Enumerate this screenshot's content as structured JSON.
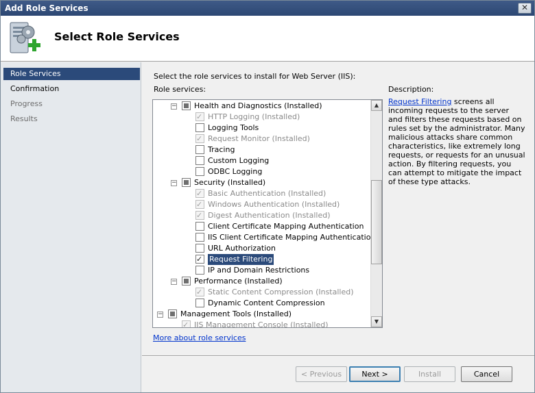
{
  "window": {
    "title": "Add Role Services",
    "close_glyph": "✕"
  },
  "header": {
    "title": "Select Role Services",
    "icon": "server-gears-add-icon"
  },
  "nav": {
    "items": [
      {
        "label": "Role Services",
        "state": "selected"
      },
      {
        "label": "Confirmation",
        "state": "normal"
      },
      {
        "label": "Progress",
        "state": "disabled"
      },
      {
        "label": "Results",
        "state": "disabled"
      }
    ]
  },
  "main": {
    "instruction": "Select the role services to install for Web Server (IIS):",
    "role_services_label": "Role services:",
    "description_label": "Description:",
    "description_link": "Request Filtering",
    "description_text": " screens all incoming requests to the server and filters these requests based on rules set by the administrator. Many malicious attacks share common characteristics, like extremely long requests, or requests for an unusual action. By filtering requests, you can attempt to mitigate the impact of these type attacks.",
    "more_link": "More about role services"
  },
  "tree": [
    {
      "label": "Health and Diagnostics",
      "suffix": "  (Installed)",
      "level": 1,
      "check": "partial",
      "expander": "⊟",
      "disabled": false
    },
    {
      "label": "HTTP Logging",
      "suffix": "  (Installed)",
      "level": 2,
      "check": "checked",
      "disabled": true
    },
    {
      "label": "Logging Tools",
      "suffix": "",
      "level": 2,
      "check": "none",
      "disabled": false
    },
    {
      "label": "Request Monitor",
      "suffix": "  (Installed)",
      "level": 2,
      "check": "checked",
      "disabled": true
    },
    {
      "label": "Tracing",
      "suffix": "",
      "level": 2,
      "check": "none",
      "disabled": false
    },
    {
      "label": "Custom Logging",
      "suffix": "",
      "level": 2,
      "check": "none",
      "disabled": false
    },
    {
      "label": "ODBC Logging",
      "suffix": "",
      "level": 2,
      "check": "none",
      "disabled": false
    },
    {
      "label": "Security",
      "suffix": "  (Installed)",
      "level": 1,
      "check": "partial",
      "expander": "⊟",
      "disabled": false
    },
    {
      "label": "Basic Authentication",
      "suffix": "  (Installed)",
      "level": 2,
      "check": "checked",
      "disabled": true
    },
    {
      "label": "Windows Authentication",
      "suffix": "  (Installed)",
      "level": 2,
      "check": "checked",
      "disabled": true
    },
    {
      "label": "Digest Authentication",
      "suffix": "  (Installed)",
      "level": 2,
      "check": "checked",
      "disabled": true
    },
    {
      "label": "Client Certificate Mapping Authentication",
      "suffix": "",
      "level": 2,
      "check": "none",
      "disabled": false
    },
    {
      "label": "IIS Client Certificate Mapping Authentication",
      "suffix": "",
      "level": 2,
      "check": "none",
      "disabled": false
    },
    {
      "label": "URL Authorization",
      "suffix": "",
      "level": 2,
      "check": "none",
      "disabled": false
    },
    {
      "label": "Request Filtering",
      "suffix": "",
      "level": 2,
      "check": "checked",
      "disabled": false,
      "selected": true
    },
    {
      "label": "IP and Domain Restrictions",
      "suffix": "",
      "level": 2,
      "check": "none",
      "disabled": false
    },
    {
      "label": "Performance",
      "suffix": "  (Installed)",
      "level": 1,
      "check": "partial",
      "expander": "⊟",
      "disabled": false
    },
    {
      "label": "Static Content Compression",
      "suffix": "  (Installed)",
      "level": 2,
      "check": "checked",
      "disabled": true
    },
    {
      "label": "Dynamic Content Compression",
      "suffix": "",
      "level": 2,
      "check": "none",
      "disabled": false
    },
    {
      "label": "Management Tools",
      "suffix": "  (Installed)",
      "level": 0,
      "check": "partial",
      "expander": "⊟",
      "disabled": false
    },
    {
      "label": "IIS Management Console",
      "suffix": "  (Installed)",
      "level": 1,
      "check": "checked",
      "disabled": true
    }
  ],
  "scrollbar": {
    "up": "▲",
    "down": "▼"
  },
  "buttons": {
    "previous": "< Previous",
    "next": "Next >",
    "install": "Install",
    "cancel": "Cancel"
  }
}
